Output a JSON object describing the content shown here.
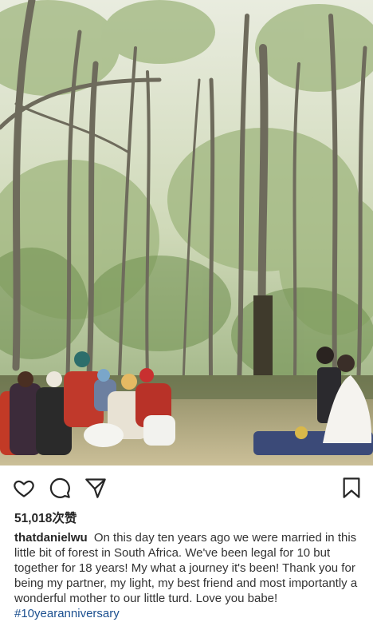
{
  "post": {
    "image_alt": "",
    "likes_count": "51,018",
    "likes_suffix": "次赞",
    "username": "thatdanielwu",
    "caption_text": "On this day ten years ago we were married in this little bit of forest in South Africa. We've been legal for 10 but together for 18 years! My what a journey it's been! Thank you for being my partner, my light, my best friend and most importantly a wonderful mother to our little turd. Love you babe!",
    "hashtag": "#10yearanniversary"
  },
  "actions": {
    "like_icon": "heart-icon",
    "comment_icon": "comment-bubble-icon",
    "share_icon": "paper-plane-icon",
    "save_icon": "bookmark-icon"
  },
  "colors": {
    "text": "#262626",
    "hashtag": "#1b4f8f",
    "background": "#ffffff"
  }
}
